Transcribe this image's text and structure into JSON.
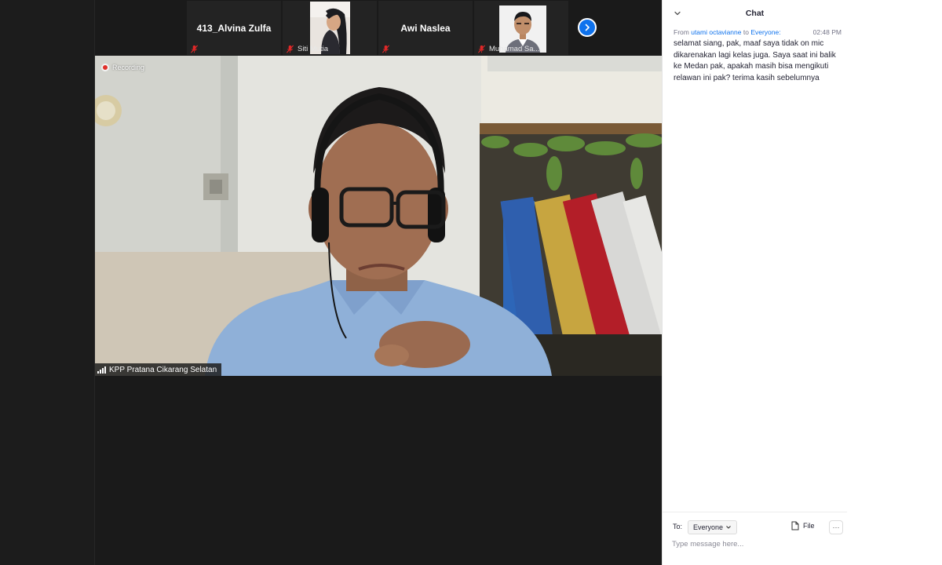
{
  "window": {
    "recording_label": "Recording",
    "active_speaker": "KPP Pratana Cikarang Selatan"
  },
  "participants": [
    {
      "name": "413_Alvina Zulfa",
      "muted": true,
      "video": false
    },
    {
      "name": "Siti Mutia",
      "muted": true,
      "video": true
    },
    {
      "name": "Awi Naslea",
      "muted": true,
      "video": false
    },
    {
      "name": "Muhamad Sa...",
      "muted": true,
      "video": true
    }
  ],
  "chat": {
    "title": "Chat",
    "messages": [
      {
        "from_prefix": "From",
        "sender": "utami octavianne",
        "to_word": "to",
        "recipient": "Everyone:",
        "time": "02:48 PM",
        "text": "selamat siang, pak, maaf saya tidak on mic dikarenakan lagi kelas juga. Saya saat ini balik ke Medan pak, apakah masih bisa mengikuti relawan ini pak? terima kasih sebelumnya"
      }
    ],
    "footer": {
      "to_label": "To:",
      "recipient": "Everyone",
      "file_label": "File",
      "more_label": "···",
      "input_placeholder": "Type message here..."
    }
  },
  "colors": {
    "accent": "#0e72ed",
    "muted_mic": "#e02828",
    "recording": "#e0302a",
    "video_bg": "#1a1a1a"
  },
  "icons": {
    "mic": "mic-muted-icon",
    "next": "chevron-right-icon",
    "collapse": "chevron-down-icon",
    "file": "file-icon",
    "signal": "signal-icon"
  }
}
